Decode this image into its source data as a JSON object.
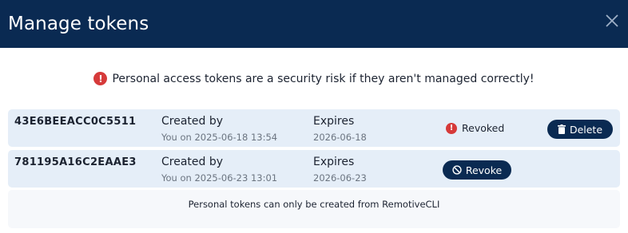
{
  "dialog": {
    "title": "Manage tokens"
  },
  "warning": {
    "text": "Personal access tokens are a security risk if they aren't managed correctly!"
  },
  "tokens": [
    {
      "id": "43E6BEEACC0C5511",
      "created_label": "Created by",
      "created_value": "You on 2025-06-18 13:54",
      "expires_label": "Expires",
      "expires_value": "2026-06-18",
      "status": "Revoked",
      "action": "Delete"
    },
    {
      "id": "781195A16C2EAAE3",
      "created_label": "Created by",
      "created_value": "You on 2025-06-23 13:01",
      "expires_label": "Expires",
      "expires_value": "2026-06-23",
      "action": "Revoke"
    }
  ],
  "footer": {
    "text": "Personal tokens can only be created from RemotiveCLI"
  },
  "colors": {
    "header": "#0a2a52",
    "row": "#e5eef8",
    "danger": "#d63a3a"
  }
}
